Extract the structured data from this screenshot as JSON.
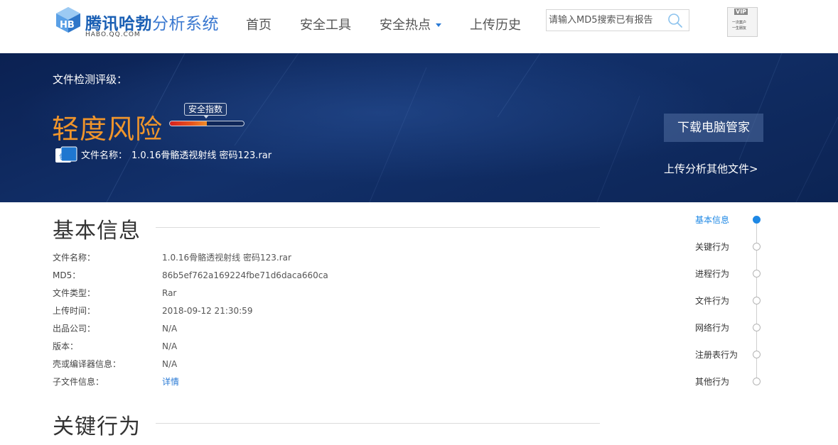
{
  "header": {
    "logo_title_bold": "腾讯哈勃",
    "logo_title_light": "分析系统",
    "logo_subtitle": "HABO.QQ.COM",
    "nav": [
      {
        "label": "首页"
      },
      {
        "label": "安全工具"
      },
      {
        "label": "安全热点",
        "has_dropdown": true
      },
      {
        "label": "上传历史"
      }
    ],
    "search": {
      "placeholder": "请输入MD5搜索已有报告",
      "value": ""
    },
    "avatar": {
      "badge": "VIP",
      "line1": "一次案户",
      "line2": "一生朋友"
    }
  },
  "banner": {
    "grade_label": "文件检测评级：",
    "risk_level": "轻度风险",
    "risk_color": "#f0952b",
    "security_index_label": "安全指数",
    "security_index_fill": 0.5,
    "file_icon_text": "包",
    "file_name_label": "文件名称：",
    "file_name": "1.0.16骨骼透视射线 密码123.rar",
    "download_button": "下载电脑管家",
    "upload_link": "上传分析其他文件>"
  },
  "basic_info": {
    "title": "基本信息",
    "rows": [
      {
        "key": "文件名称：",
        "value": "1.0.16骨骼透视射线 密码123.rar"
      },
      {
        "key": "MD5：",
        "value": "86b5ef762a169224fbe71d6daca660ca"
      },
      {
        "key": "文件类型：",
        "value": "Rar"
      },
      {
        "key": "上传时间：",
        "value": "2018-09-12 21:30:59"
      },
      {
        "key": "出品公司：",
        "value": "N/A"
      },
      {
        "key": "版本：",
        "value": "N/A"
      },
      {
        "key": "壳或编译器信息：",
        "value": "N/A"
      },
      {
        "key": "子文件信息：",
        "value": "详情",
        "is_link": true
      }
    ]
  },
  "key_behavior": {
    "title": "关键行为"
  },
  "sidenav": {
    "active_color": "#1e88e5",
    "items": [
      {
        "label": "基本信息",
        "active": true
      },
      {
        "label": "关键行为"
      },
      {
        "label": "进程行为"
      },
      {
        "label": "文件行为"
      },
      {
        "label": "网络行为"
      },
      {
        "label": "注册表行为"
      },
      {
        "label": "其他行为"
      }
    ]
  }
}
